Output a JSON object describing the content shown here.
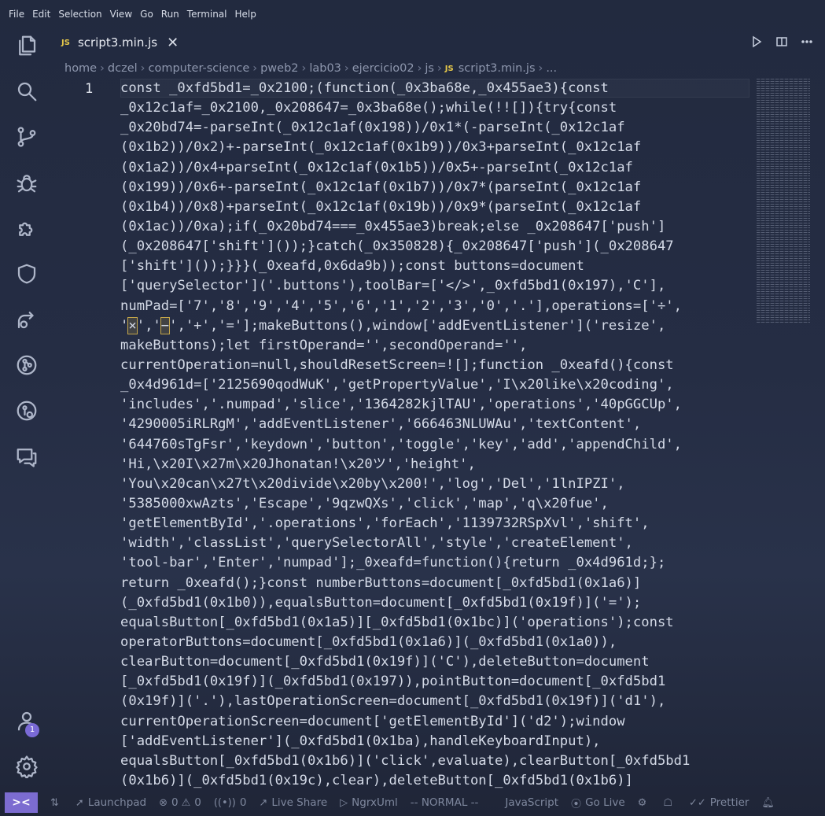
{
  "menu": [
    "File",
    "Edit",
    "Selection",
    "View",
    "Go",
    "Run",
    "Terminal",
    "Help"
  ],
  "tab": {
    "badge": "JS",
    "title": "script3.min.js",
    "close": "✕"
  },
  "breadcrumb": [
    "home",
    "dczel",
    "computer-science",
    "pweb2",
    "lab03",
    "ejercicio02",
    "js",
    "script3.min.js",
    "..."
  ],
  "breadcrumb_badge": "JS",
  "editor": {
    "line_number": "1",
    "lines": [
      "const _0xfd5bd1=_0x2100;(function(_0x3ba68e,_0x455ae3){const",
      "_0x12c1af=_0x2100,_0x208647=_0x3ba68e();while(!![]){try{const",
      "_0x20bd74=-parseInt(_0x12c1af(0x198))/0x1*(-parseInt(_0x12c1af",
      "(0x1b2))/0x2)+-parseInt(_0x12c1af(0x1b9))/0x3+parseInt(_0x12c1af",
      "(0x1a2))/0x4+parseInt(_0x12c1af(0x1b5))/0x5+-parseInt(_0x12c1af",
      "(0x199))/0x6+-parseInt(_0x12c1af(0x1b7))/0x7*(parseInt(_0x12c1af",
      "(0x1b4))/0x8)+parseInt(_0x12c1af(0x19b))/0x9*(parseInt(_0x12c1af",
      "(0x1ac))/0xa);if(_0x20bd74===_0x455ae3)break;else _0x208647['push']",
      "(_0x208647['shift']());}catch(_0x350828){_0x208647['push'](_0x208647",
      "['shift']());}}}(_0xeafd,0x6da9b));const buttons=document",
      "['querySelector']('.buttons'),toolBar=['</>',_0xfd5bd1(0x197),'C'],",
      "numPad=['7','8','9','4','5','6','1','2','3','0','.'],operations=['÷',",
      "'×','−','+','='];makeButtons(),window['addEventListener']('resize',",
      "makeButtons);let firstOperand='',secondOperand='',",
      "currentOperation=null,shouldResetScreen=![];function _0xeafd(){const",
      "_0x4d961d=['2125690qodWuK','getPropertyValue','I\\x20like\\x20coding',",
      "'includes','.numpad','slice','1364282kjlTAU','operations','40pGGCUp',",
      "'4290005iRLRgM','addEventListener','666463NLUWAu','textContent',",
      "'644760sTgFsr','keydown','button','toggle','key','add','appendChild',",
      "'Hi,\\x20I\\x27m\\x20Jhonatan!\\x20ツ','height',",
      "'You\\x20can\\x27t\\x20divide\\x20by\\x200!','log','Del','1lnIPZI',",
      "'5385000xwAzts','Escape','9qzwQXs','click','map','q\\x20fue',",
      "'getElementById','.operations','forEach','1139732RSpXvl','shift',",
      "'width','classList','querySelectorAll','style','createElement',",
      "'tool-bar','Enter','numpad'];_0xeafd=function(){return _0x4d961d;};",
      "return _0xeafd();}const numberButtons=document[_0xfd5bd1(0x1a6)]",
      "(_0xfd5bd1(0x1b0)),equalsButton=document[_0xfd5bd1(0x19f)]('=');",
      "equalsButton[_0xfd5bd1(0x1a5)][_0xfd5bd1(0x1bc)]('operations');const",
      "operatorButtons=document[_0xfd5bd1(0x1a6)](_0xfd5bd1(0x1a0)),",
      "clearButton=document[_0xfd5bd1(0x19f)]('C'),deleteButton=document",
      "[_0xfd5bd1(0x19f)](_0xfd5bd1(0x197)),pointButton=document[_0xfd5bd1",
      "(0x19f)]('.'),lastOperationScreen=document[_0xfd5bd1(0x19f)]('d1'),",
      "currentOperationScreen=document['getElementById']('d2');window",
      "['addEventListener'](_0xfd5bd1(0x1ba),handleKeyboardInput),",
      "equalsButton[_0xfd5bd1(0x1b6)]('click',evaluate),clearButton[_0xfd5bd1",
      "(0x1b6)](_0xfd5bd1(0x19c),clear),deleteButton[_0xfd5bd1(0x1b6)]"
    ]
  },
  "status": {
    "remote": "><",
    "launchpad": "Launchpad",
    "errors": "0",
    "warnings": "0",
    "ports": "0",
    "live_share": "Live Share",
    "ngrx": "NgrxUml",
    "mode": "-- NORMAL --",
    "language": "JavaScript",
    "go_live": "Go Live",
    "prettier": "Prettier"
  },
  "accounts_badge": "1",
  "colors": {
    "accent": "#7c6cd0",
    "js_badge": "#e6c84a",
    "background": "#252d44"
  }
}
